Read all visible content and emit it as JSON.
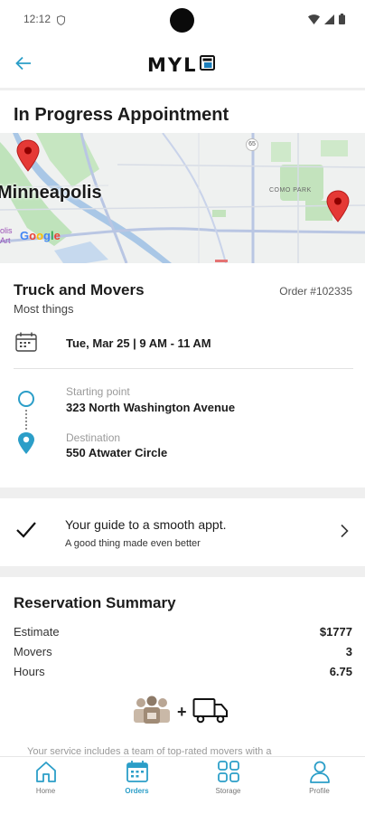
{
  "status_bar": {
    "time": "12:12"
  },
  "header": {
    "logo_text": "MYL"
  },
  "page_title": "In Progress Appointment",
  "map": {
    "city_label": "Minneapolis",
    "area_label": "COMO PARK",
    "art_label_line1": "olis",
    "art_label_line2": "Art",
    "google_label": "Google",
    "road_label": "65"
  },
  "order": {
    "service": "Truck and Movers",
    "subtitle": "Most things",
    "order_number": "Order #102335",
    "datetime": "Tue, Mar 25 | 9 AM - 11 AM",
    "start_label": "Starting point",
    "start_address": "323 North Washington Avenue",
    "dest_label": "Destination",
    "dest_address": "550 Atwater Circle"
  },
  "guide": {
    "title": "Your guide to a smooth appt.",
    "subtitle": "A good thing made even better"
  },
  "summary": {
    "title": "Reservation Summary",
    "rows": [
      {
        "label": "Estimate",
        "value": "$1777"
      },
      {
        "label": "Movers",
        "value": "3"
      },
      {
        "label": "Hours",
        "value": "6.75"
      }
    ],
    "plus": "+",
    "note": "Your service includes a team of top-rated movers with a"
  },
  "nav": {
    "items": [
      {
        "label": "Home",
        "icon": "home-icon"
      },
      {
        "label": "Orders",
        "icon": "calendar-icon"
      },
      {
        "label": "Storage",
        "icon": "grid-icon"
      },
      {
        "label": "Profile",
        "icon": "person-icon"
      }
    ],
    "active_index": 1
  },
  "colors": {
    "accent": "#2b9ec8",
    "pin_red": "#e53935",
    "map_water": "#a9c7e6",
    "map_green": "#b9dfb4",
    "logo_blue": "#1c7fbc"
  }
}
